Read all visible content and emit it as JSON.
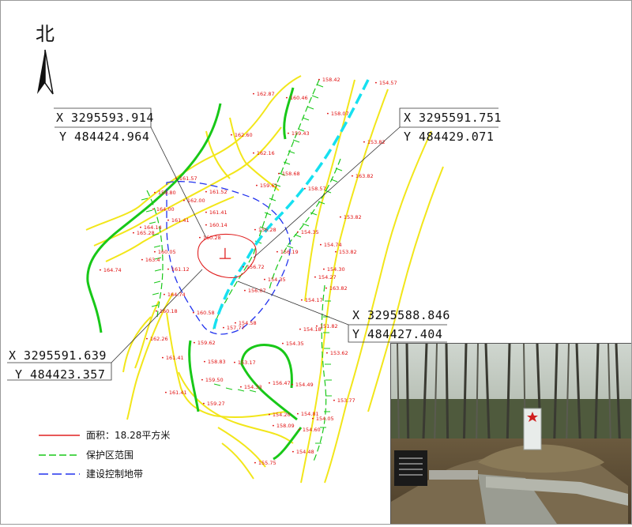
{
  "north_label": "北",
  "coordinates": [
    {
      "x": "X  3295593.914",
      "y": "Y  484424.964"
    },
    {
      "x": "X  3295591.751",
      "y": "Y  484429.071"
    },
    {
      "x": "X  3295588.846",
      "y": "Y  484427.404"
    },
    {
      "x": "X  3295591.639",
      "y": "Y  484423.357"
    }
  ],
  "legend": {
    "area": {
      "label": "面积：18.28平方米",
      "color": "#e02020"
    },
    "protection": {
      "label": "保护区范围",
      "color": "#22bb22"
    },
    "control": {
      "label": "建设控制地带",
      "color": "#2233ee"
    }
  },
  "colors": {
    "contour_yellow": "#f2e61a",
    "contour_green": "#18c818",
    "stream_cyan": "#16e0f0",
    "elevation_text": "#e01010"
  },
  "elevations": [
    "158.42",
    "154.57",
    "162.87",
    "160.46",
    "158.07",
    "162.60",
    "159.43",
    "153.82",
    "162.16",
    "161.57",
    "158.68",
    "163.82",
    "159.61",
    "158.57",
    "159.80",
    "161.52",
    "162.00",
    "161.41",
    "164.00",
    "161.41",
    "160.14",
    "164.14",
    "160.28",
    "153.82",
    "165.28",
    "156.28",
    "154.35",
    "160.05",
    "154.74",
    "153.82",
    "163.4",
    "156.19",
    "161.12",
    "156.72",
    "154.30",
    "154.27",
    "164.74",
    "154.35",
    "163.82",
    "164.74",
    "156.07",
    "154.17",
    "160.18",
    "160.58",
    "154.58",
    "157.77",
    "154.18",
    "151.82",
    "162.26",
    "159.62",
    "154.35",
    "153.62",
    "161.41",
    "158.83",
    "153.17",
    "159.50",
    "156.47",
    "154.49",
    "161.41",
    "154.33",
    "159.27",
    "153.77",
    "154.20",
    "154.81",
    "158.09",
    "154.05",
    "154.60",
    "154.48",
    "155.75"
  ],
  "site_symbol": "丄",
  "photo": {
    "subject": "memorial-tomb-in-forest"
  }
}
